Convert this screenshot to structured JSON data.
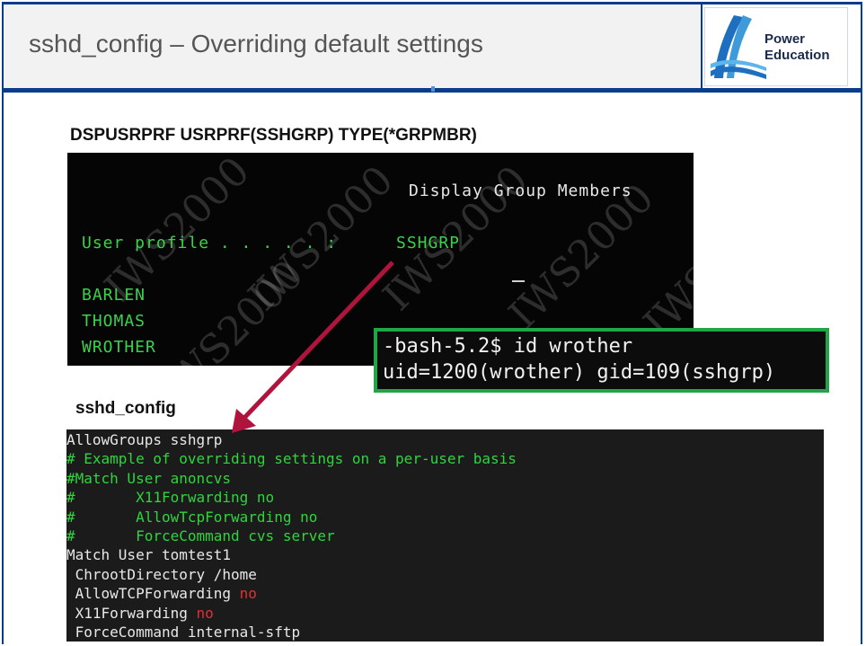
{
  "slide": {
    "title": "sshd_config – Overriding default settings",
    "logo": {
      "line1": "Power",
      "line2": "Education"
    }
  },
  "command_heading": "DSPUSRPRF USRPRF(SSHGRP) TYPE(*GRPMBR)",
  "green_screen": {
    "title": "Display Group Members",
    "field_label": "User profile . . . . . :",
    "field_value": "SSHGRP",
    "members": [
      "BARLEN",
      "THOMAS",
      "WROTHER"
    ],
    "watermark": "IWS2000"
  },
  "bash": {
    "prompt_line": "-bash-5.2$ id wrother",
    "output_line": "uid=1200(wrother) gid=109(sshgrp)"
  },
  "config_heading": "sshd_config",
  "config_lines": [
    {
      "text": "AllowGroups sshgrp",
      "suffix": "",
      "style": "white"
    },
    {
      "text": "# Example of overriding settings on a per-user basis",
      "suffix": "",
      "style": "green"
    },
    {
      "text": "#Match User anoncvs",
      "suffix": "",
      "style": "green"
    },
    {
      "text": "#       X11Forwarding no",
      "suffix": "",
      "style": "green"
    },
    {
      "text": "#       AllowTcpForwarding no",
      "suffix": "",
      "style": "green"
    },
    {
      "text": "#       ForceCommand cvs server",
      "suffix": "",
      "style": "green"
    },
    {
      "text": "Match User tomtest1",
      "suffix": "",
      "style": "white"
    },
    {
      "text": " ChrootDirectory /home",
      "suffix": "",
      "style": "white"
    },
    {
      "text": " AllowTCPForwarding ",
      "suffix": "no",
      "style": "white"
    },
    {
      "text": " X11Forwarding ",
      "suffix": "no",
      "style": "white"
    },
    {
      "text": " ForceCommand internal-sftp",
      "suffix": "",
      "style": "white"
    }
  ],
  "colors": {
    "brand_blue": "#0a3c8c",
    "terminal_green": "#39d34a",
    "highlight_box": "#22a546",
    "arrow": "#b0143c",
    "keyword_red": "#e03131"
  }
}
